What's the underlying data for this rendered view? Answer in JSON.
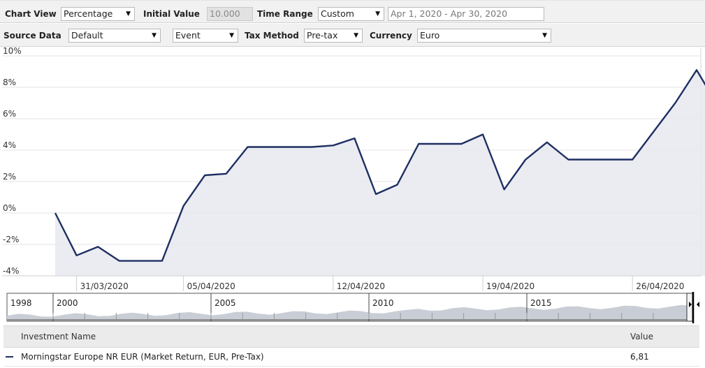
{
  "toolbar1": {
    "chart_view_label": "Chart View",
    "chart_view_value": "Percentage",
    "initial_value_label": "Initial Value",
    "initial_value": "10.000",
    "time_range_label": "Time Range",
    "time_range_value": "Custom",
    "date_range": "Apr 1, 2020 - Apr 30, 2020"
  },
  "toolbar2": {
    "source_data_label": "Source Data",
    "source_data_value": "Default",
    "event_value": "Event",
    "tax_method_label": "Tax Method",
    "tax_method_value": "Pre-tax",
    "currency_label": "Currency",
    "currency_value": "Euro"
  },
  "dropdown_arrow": "▼",
  "chart_data": {
    "type": "area",
    "ylim": [
      -4,
      10
    ],
    "y_ticks": [
      "10%",
      "8%",
      "6%",
      "4%",
      "2%",
      "0%",
      "-2%",
      "-4%"
    ],
    "x_ticks": [
      "31/03/2020",
      "05/04/2020",
      "12/04/2020",
      "19/04/2020",
      "26/04/2020"
    ],
    "series": [
      {
        "name": "Morningstar Europe NR EUR (Market Return, EUR, Pre-Tax)",
        "color": "#1f2f63",
        "fill": "#e8e9f0",
        "x": [
          "30/03/2020",
          "31/03/2020",
          "01/04/2020",
          "02/04/2020",
          "03/04/2020",
          "04/04/2020",
          "05/04/2020",
          "06/04/2020",
          "07/04/2020",
          "08/04/2020",
          "09/04/2020",
          "10/04/2020",
          "11/04/2020",
          "12/04/2020",
          "13/04/2020",
          "14/04/2020",
          "15/04/2020",
          "16/04/2020",
          "17/04/2020",
          "18/04/2020",
          "19/04/2020",
          "20/04/2020",
          "21/04/2020",
          "22/04/2020",
          "23/04/2020",
          "24/04/2020",
          "25/04/2020",
          "26/04/2020",
          "27/04/2020",
          "28/04/2020",
          "29/04/2020",
          "30/04/2020"
        ],
        "values": [
          0.0,
          -2.7,
          -2.15,
          -3.05,
          -3.05,
          -3.05,
          0.45,
          2.4,
          2.5,
          4.2,
          4.2,
          4.2,
          4.2,
          4.3,
          4.75,
          1.2,
          1.8,
          4.4,
          4.4,
          4.4,
          5.0,
          1.5,
          3.4,
          4.5,
          3.4,
          3.4,
          3.4,
          3.4,
          5.2,
          7.0,
          9.1,
          6.81
        ]
      }
    ]
  },
  "navigator": {
    "years": [
      "1998",
      "2000",
      "2005",
      "2010",
      "2015"
    ]
  },
  "table": {
    "headers": {
      "name": "Investment Name",
      "value": "Value"
    },
    "rows": [
      {
        "name": "Morningstar Europe NR EUR (Market Return, EUR, Pre-Tax)",
        "value": "6,81"
      }
    ]
  }
}
